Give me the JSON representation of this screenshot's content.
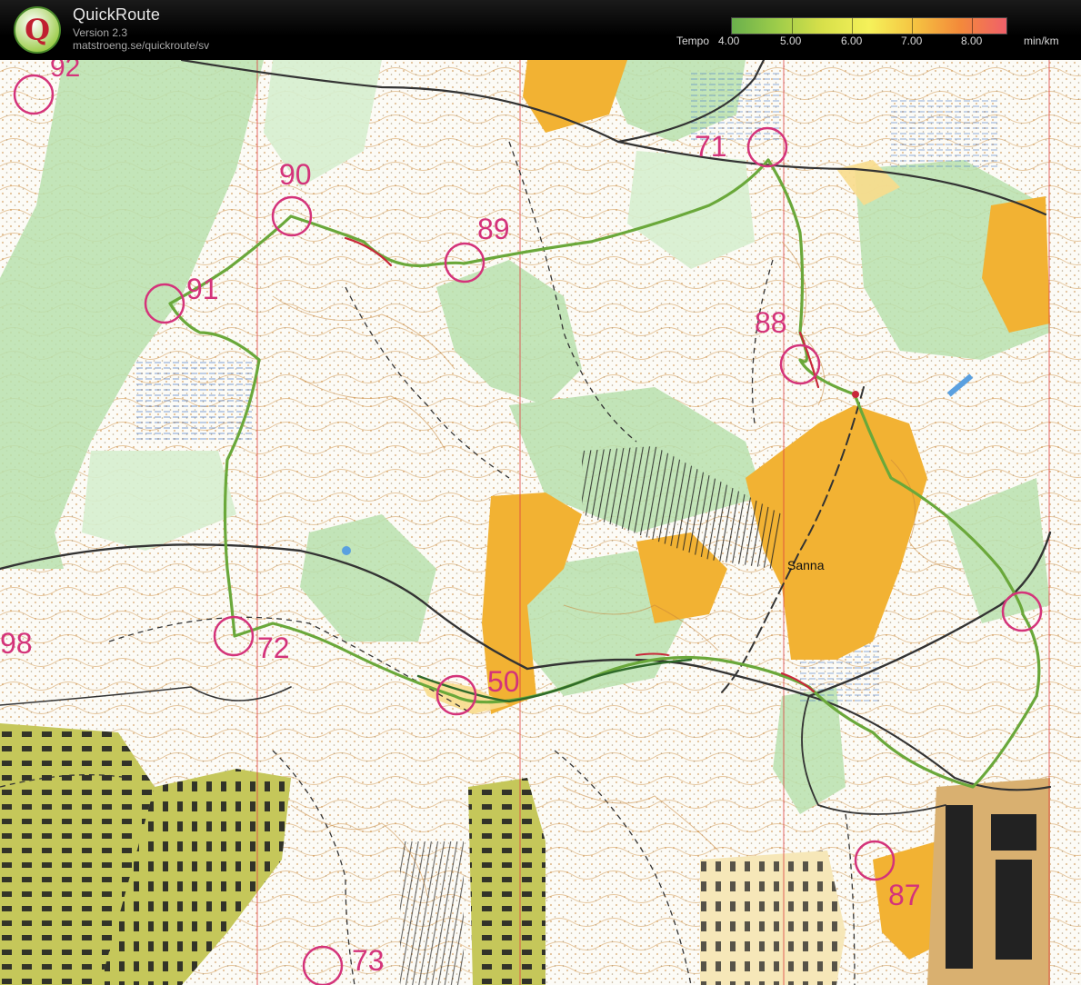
{
  "app": {
    "title": "QuickRoute",
    "version": "Version 2.3",
    "url": "matstroeng.se/quickroute/sv"
  },
  "logo_glyph": "Q",
  "pace_scale": {
    "title": "Tempo",
    "unit": "min/km",
    "ticks": [
      "4.00",
      "5.00",
      "6.00",
      "7.00",
      "8.00"
    ],
    "colors": [
      "#6ab04c",
      "#9ccc4a",
      "#d8e04a",
      "#f5f15a",
      "#f5c542",
      "#f38a3a",
      "#f0606a"
    ]
  },
  "map": {
    "controls": [
      {
        "label": "92"
      },
      {
        "label": "90"
      },
      {
        "label": "89"
      },
      {
        "label": "91"
      },
      {
        "label": "71"
      },
      {
        "label": "88"
      },
      {
        "label": "72"
      },
      {
        "label": "50"
      },
      {
        "label": "98"
      },
      {
        "label": "87"
      },
      {
        "label": "73"
      },
      {
        "label": ""
      }
    ],
    "place_label": "Sanna",
    "colors": {
      "forest": "#ffffff",
      "green": "#a8d8a0",
      "light_green": "#cde9c4",
      "open_land": "#f2b233",
      "rough_open": "#f8dc8c",
      "contour": "#c8873a",
      "control": "#d4337a",
      "route_green": "#5a9a3a",
      "route_red": "#c8283a",
      "road": "#333333",
      "settlement": "#c5c75a",
      "meridian": "#e04040"
    }
  }
}
